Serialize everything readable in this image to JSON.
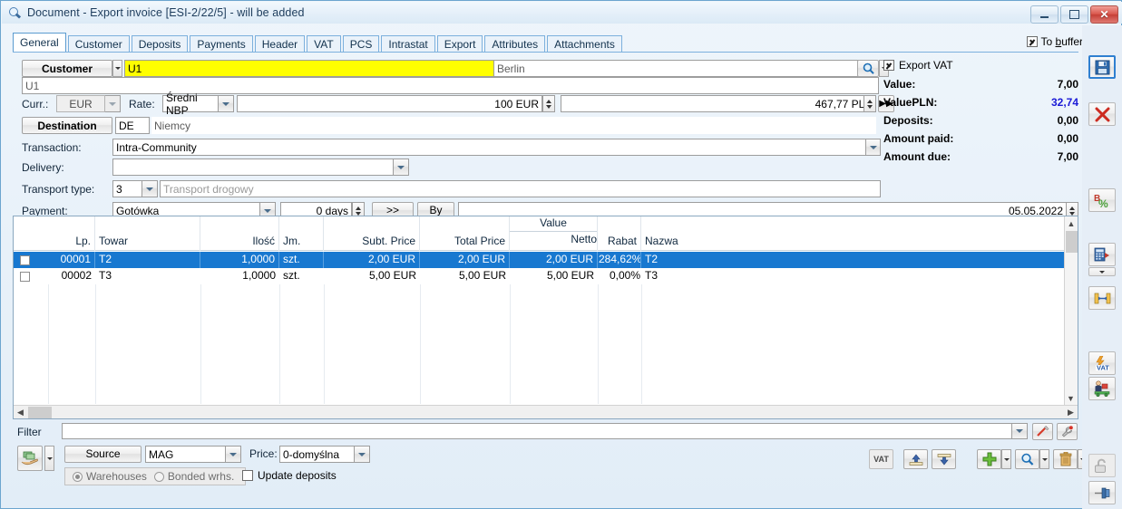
{
  "window": {
    "title": "Document - Export invoice [ESI-2/22/5]  - will be added",
    "icon": "magnifier-icon",
    "minimize": "minimize",
    "maximize": "maximize",
    "close": "close"
  },
  "tabs": [
    {
      "label": "General",
      "active": true
    },
    {
      "label": "Customer",
      "active": false
    },
    {
      "label": "Deposits",
      "active": false
    },
    {
      "label": "Payments",
      "active": false
    },
    {
      "label": "Header",
      "active": false
    },
    {
      "label": "VAT",
      "active": false
    },
    {
      "label": "PCS",
      "active": false
    },
    {
      "label": "Intrastat",
      "active": false
    },
    {
      "label": "Export",
      "active": false
    },
    {
      "label": "Attributes",
      "active": false
    },
    {
      "label": "Attachments",
      "active": false
    }
  ],
  "to_buffer": {
    "label_pre": "To ",
    "label_underline": "b",
    "label_post": "uffer",
    "checked": true
  },
  "form": {
    "customer_button": "Customer",
    "customer_code": "U1",
    "customer_city": "Berlin",
    "customer_name": "U1",
    "curr_label": "Curr.:",
    "currency": "EUR",
    "rate_label": "Rate:",
    "rate_type": "Średni NBP",
    "rate_amount": "100 EUR",
    "rate_value": "467,77 PLN",
    "destination_button": "Destination",
    "destination_code": "DE",
    "destination_name": "Niemcy",
    "transaction_label": "Transaction:",
    "transaction_value": "Intra-Community",
    "delivery_label": "Delivery:",
    "delivery_value": "",
    "transport_label": "Transport type:",
    "transport_code": "3",
    "transport_name": "Transport drogowy",
    "payment_label": "Payment:",
    "payment_method": "Gotówka",
    "payment_days": "0 days",
    "payment_more": ">>",
    "payment_by": "By",
    "payment_by_value": "",
    "payment_date": "05.05.2022"
  },
  "summary": {
    "export_vat_label": "Export VAT",
    "export_vat_checked": true,
    "rows": [
      {
        "label": "Value:",
        "value": "7,00",
        "blue": false
      },
      {
        "label": "ValuePLN:",
        "value": "32,74",
        "blue": true
      },
      {
        "label": "Deposits:",
        "value": "0,00",
        "blue": false
      },
      {
        "label": "Amount paid:",
        "value": "0,00",
        "blue": false
      },
      {
        "label": "Amount due:",
        "value": "7,00",
        "blue": false
      }
    ]
  },
  "grid": {
    "columns": [
      {
        "label": "Lp.",
        "align": "right"
      },
      {
        "label": "Towar",
        "align": "left"
      },
      {
        "label": "Ilość",
        "align": "right"
      },
      {
        "label": "Jm.",
        "align": "left"
      },
      {
        "label": "Subt. Price",
        "align": "right"
      },
      {
        "label": "Total Price",
        "align": "right"
      },
      {
        "label": "Value",
        "label2": "Netto",
        "align": "right"
      },
      {
        "label": "Rabat",
        "align": "right"
      },
      {
        "label": "Nazwa",
        "align": "left"
      }
    ],
    "rows": [
      {
        "selected": true,
        "lp": "00001",
        "towar": "T2",
        "ilosc": "1,0000",
        "jm": "szt.",
        "subt": "2,00 EUR",
        "total": "2,00 EUR",
        "netto": "2,00 EUR",
        "rabat": "284,62%",
        "nazwa": "T2"
      },
      {
        "selected": false,
        "lp": "00002",
        "towar": "T3",
        "ilosc": "1,0000",
        "jm": "szt.",
        "subt": "5,00 EUR",
        "total": "5,00 EUR",
        "netto": "5,00 EUR",
        "rabat": "0,00%",
        "nazwa": "T3"
      }
    ]
  },
  "bottom": {
    "filter_label": "Filter",
    "filter_value": "",
    "source_button": "Source",
    "source_value": "MAG",
    "price_label": "Price:",
    "price_value": "0-domyślna",
    "warehouses_label": "Warehouses",
    "warehouses_selected": true,
    "bonded_label": "Bonded wrhs.",
    "bonded_selected": false,
    "update_deposits_label": "Update deposits",
    "update_deposits_checked": false,
    "vat_button": "VAT"
  },
  "icons": {
    "save": "save-disk-icon",
    "cancel": "red-x-icon",
    "discount": "b-percent-icon",
    "calc_export": "calculator-export-icon",
    "link": "link-items-icon",
    "vat_flash": "vat-flash-icon",
    "delivery_person": "delivery-person-icon",
    "unlock": "padlock-open-icon",
    "pin": "pin-icon",
    "money": "money-hand-icon",
    "pencil": "clear-filter-icon",
    "wrench": "filter-settings-icon",
    "up_box": "move-up-icon",
    "down_box": "move-down-icon",
    "plus": "add-icon",
    "magnify": "search-icon",
    "trash": "delete-icon"
  }
}
